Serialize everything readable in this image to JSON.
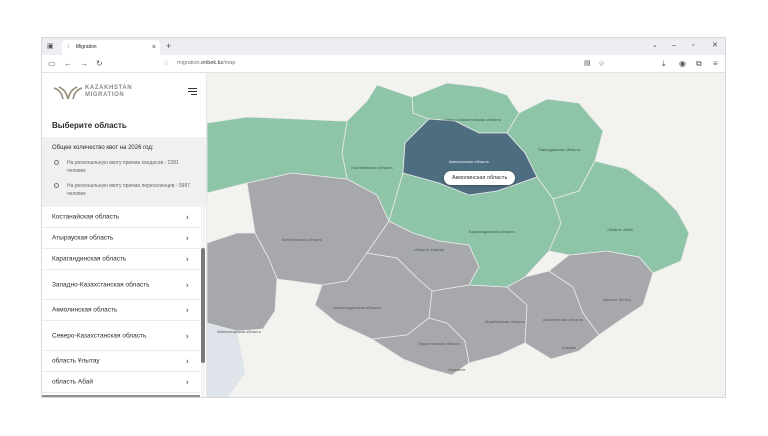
{
  "browser": {
    "tab_title": "Migration",
    "url_prefix": "migration.",
    "url_domain": "enbek.kz",
    "url_path": "/map"
  },
  "sidebar": {
    "brand_line1": "KAZAKHSTAN",
    "brand_line2": "MIGRATION",
    "title": "Выберите область",
    "quota": {
      "title": "Общее количество квот на 2026 год:",
      "line1": "На региональную квоту приема кандасов - 2281 человек",
      "line2": "На региональную квоту приема переселенцев - 5997 человек"
    },
    "regions": [
      {
        "label": "Костанайская область"
      },
      {
        "label": "Атырауская область"
      },
      {
        "label": "Карагандинская область"
      },
      {
        "label": "Западно-Казахстанская область"
      },
      {
        "label": "Акмолинская область"
      },
      {
        "label": "Северо-Казахстанская область"
      },
      {
        "label": "область Ұлытау"
      },
      {
        "label": "область Абай"
      }
    ]
  },
  "map": {
    "tooltip": "Акмолинская область",
    "region_labels": {
      "sko": "Северо-Казахстанская область",
      "kostanay": "Костанайская область",
      "akmola": "Акмолинская область",
      "astana": "Астана",
      "pavlodar": "Павлодарская область",
      "aktobe": "Актюбинская область",
      "ulytau": "область Ұлытау",
      "karaganda": "Карагандинская область",
      "abai": "область Абай",
      "mangystau": "Мангистауская область",
      "kyzylorda": "Кызылординская область",
      "turkestan": "Туркестанская область",
      "zhambyl": "Жамбылская область",
      "almaty_obl": "Алматинская область",
      "zhetisu": "область Жетісу",
      "almaty": "Алматы",
      "shymkent": "Шымкент"
    },
    "info_label": "i",
    "colors": {
      "green": "#8ec5a8",
      "grey": "#a7a8ab",
      "selected": "#4f6d81",
      "background": "#f2f2ef"
    }
  }
}
